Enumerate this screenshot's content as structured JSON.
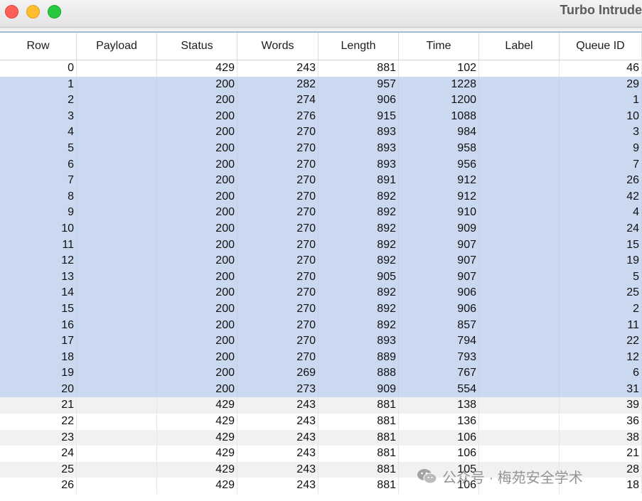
{
  "window": {
    "title": "Turbo Intrude"
  },
  "table": {
    "columns": [
      "Row",
      "Payload",
      "Status",
      "Words",
      "Length",
      "Time",
      "Label",
      "Queue ID"
    ],
    "selected_rows": [
      1,
      2,
      3,
      4,
      5,
      6,
      7,
      8,
      9,
      10,
      11,
      12,
      13,
      14,
      15,
      16,
      17,
      18,
      19,
      20
    ],
    "rows": [
      [
        "0",
        "",
        "429",
        "243",
        "881",
        "102",
        "",
        "46"
      ],
      [
        "1",
        "",
        "200",
        "282",
        "957",
        "1228",
        "",
        "29"
      ],
      [
        "2",
        "",
        "200",
        "274",
        "906",
        "1200",
        "",
        "1"
      ],
      [
        "3",
        "",
        "200",
        "276",
        "915",
        "1088",
        "",
        "10"
      ],
      [
        "4",
        "",
        "200",
        "270",
        "893",
        "984",
        "",
        "3"
      ],
      [
        "5",
        "",
        "200",
        "270",
        "893",
        "958",
        "",
        "9"
      ],
      [
        "6",
        "",
        "200",
        "270",
        "893",
        "956",
        "",
        "7"
      ],
      [
        "7",
        "",
        "200",
        "270",
        "891",
        "912",
        "",
        "26"
      ],
      [
        "8",
        "",
        "200",
        "270",
        "892",
        "912",
        "",
        "42"
      ],
      [
        "9",
        "",
        "200",
        "270",
        "892",
        "910",
        "",
        "4"
      ],
      [
        "10",
        "",
        "200",
        "270",
        "892",
        "909",
        "",
        "24"
      ],
      [
        "11",
        "",
        "200",
        "270",
        "892",
        "907",
        "",
        "15"
      ],
      [
        "12",
        "",
        "200",
        "270",
        "892",
        "907",
        "",
        "19"
      ],
      [
        "13",
        "",
        "200",
        "270",
        "905",
        "907",
        "",
        "5"
      ],
      [
        "14",
        "",
        "200",
        "270",
        "892",
        "906",
        "",
        "25"
      ],
      [
        "15",
        "",
        "200",
        "270",
        "892",
        "906",
        "",
        "2"
      ],
      [
        "16",
        "",
        "200",
        "270",
        "892",
        "857",
        "",
        "11"
      ],
      [
        "17",
        "",
        "200",
        "270",
        "893",
        "794",
        "",
        "22"
      ],
      [
        "18",
        "",
        "200",
        "270",
        "889",
        "793",
        "",
        "12"
      ],
      [
        "19",
        "",
        "200",
        "269",
        "888",
        "767",
        "",
        "6"
      ],
      [
        "20",
        "",
        "200",
        "273",
        "909",
        "554",
        "",
        "31"
      ],
      [
        "21",
        "",
        "429",
        "243",
        "881",
        "138",
        "",
        "39"
      ],
      [
        "22",
        "",
        "429",
        "243",
        "881",
        "136",
        "",
        "36"
      ],
      [
        "23",
        "",
        "429",
        "243",
        "881",
        "106",
        "",
        "38"
      ],
      [
        "24",
        "",
        "429",
        "243",
        "881",
        "106",
        "",
        "21"
      ],
      [
        "25",
        "",
        "429",
        "243",
        "881",
        "105",
        "",
        "28"
      ],
      [
        "26",
        "",
        "429",
        "243",
        "881",
        "106",
        "",
        "18"
      ]
    ]
  },
  "watermark": {
    "text": "公众号 · 梅苑安全学术",
    "icon": "wechat-icon"
  },
  "colors": {
    "selection": "#cbd9f0",
    "stripe": "#f1f1f1",
    "close": "#fe5f57",
    "minimize": "#febc2e",
    "zoom": "#28c840"
  }
}
